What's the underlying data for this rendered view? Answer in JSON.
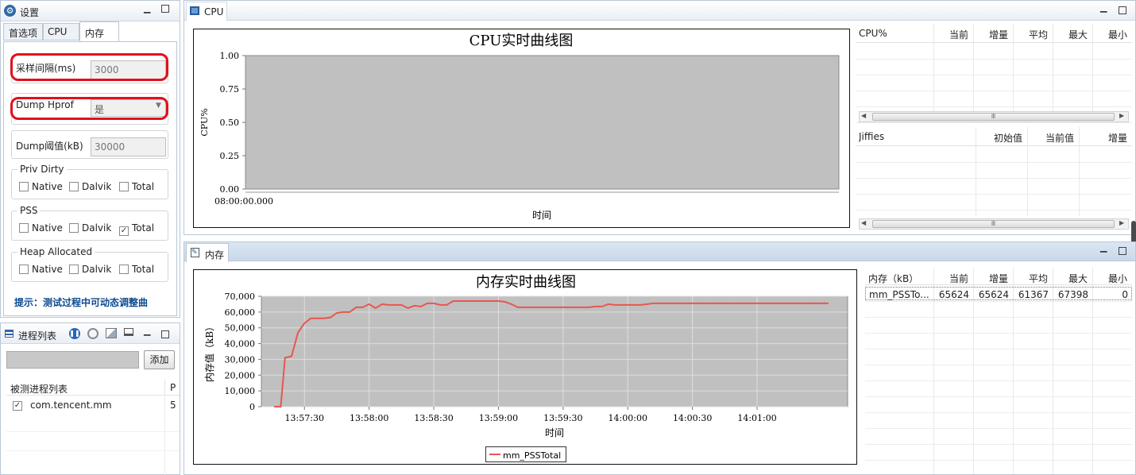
{
  "settings": {
    "title": "设置",
    "tabs": [
      "首选项",
      "CPU",
      "内存"
    ],
    "active_tab": 2,
    "sample_interval_label": "采样间隔(ms)",
    "sample_interval_value": "3000",
    "dump_hprof_label": "Dump Hprof",
    "dump_hprof_value": "是",
    "dump_threshold_label": "Dump阈值(kB)",
    "dump_threshold_value": "30000",
    "groups": [
      {
        "title": "Priv Dirty",
        "options": [
          {
            "label": "Native",
            "checked": false
          },
          {
            "label": "Dalvik",
            "checked": false
          },
          {
            "label": "Total",
            "checked": false
          }
        ]
      },
      {
        "title": "PSS",
        "options": [
          {
            "label": "Native",
            "checked": false
          },
          {
            "label": "Dalvik",
            "checked": false
          },
          {
            "label": "Total",
            "checked": true
          }
        ]
      },
      {
        "title": "Heap Allocated",
        "options": [
          {
            "label": "Native",
            "checked": false
          },
          {
            "label": "Dalvik",
            "checked": false
          },
          {
            "label": "Total",
            "checked": false
          }
        ]
      }
    ],
    "hint": "提示：测试过程中可动态调整曲"
  },
  "process": {
    "title": "进程列表",
    "input_value": "",
    "add_button": "添加",
    "columns": [
      "被测进程列表",
      "P"
    ],
    "rows": [
      {
        "name": "com.tencent.mm",
        "p": "5",
        "checked": true
      }
    ]
  },
  "cpu": {
    "tab_title": "CPU",
    "table1_columns": [
      "CPU%",
      "当前",
      "增量",
      "平均",
      "最大",
      "最小"
    ],
    "table2_columns": [
      "Jiffies",
      "初始值",
      "当前值",
      "增量"
    ],
    "scroll_grip": "Ⅲ"
  },
  "memory": {
    "tab_title": "内存",
    "table_columns": [
      "内存（kB）",
      "当前",
      "增量",
      "平均",
      "最大",
      "最小"
    ],
    "table_rows": [
      [
        "mm_PSSTo...",
        "65624",
        "65624",
        "61367",
        "67398",
        "0"
      ]
    ]
  },
  "chart_data": [
    {
      "type": "line",
      "title": "CPU实时曲线图",
      "xlabel": "时间",
      "ylabel": "CPU%",
      "x_ticks": [
        "08:00:00.000"
      ],
      "y_ticks": [
        "1.00",
        "0.75",
        "0.50",
        "0.25",
        "0.00"
      ],
      "ylim": [
        0,
        1
      ],
      "series": [],
      "grid": false,
      "background": "#c0c0c0"
    },
    {
      "type": "line",
      "title": "内存实时曲线图",
      "xlabel": "时间",
      "ylabel": "内存值（kB）",
      "x_ticks": [
        "13:57:30",
        "13:58:00",
        "13:58:30",
        "13:59:00",
        "13:59:30",
        "14:00:00",
        "14:00:30",
        "14:01:00"
      ],
      "y_ticks": [
        "70,000",
        "60,000",
        "50,000",
        "40,000",
        "30,000",
        "20,000",
        "10,000",
        "0"
      ],
      "xlim": [
        -20,
        252
      ],
      "ylim": [
        0,
        70000
      ],
      "grid": true,
      "legend": "bottom-center",
      "background": "#c0c0c0",
      "series": [
        {
          "name": "mm_PSSTotal",
          "color": "#e8574e",
          "x": [
            -14,
            -11,
            -9,
            -6,
            -3,
            0,
            3,
            6,
            9,
            12,
            15,
            18,
            21,
            24,
            27,
            30,
            33,
            36,
            39,
            42,
            45,
            48,
            51,
            54,
            57,
            60,
            63,
            66,
            69,
            72,
            75,
            78,
            81,
            84,
            87,
            90,
            93,
            96,
            99,
            102,
            105,
            108,
            111,
            114,
            117,
            120,
            123,
            126,
            129,
            132,
            135,
            138,
            141,
            144,
            147,
            150,
            153,
            156,
            159,
            162,
            165,
            168,
            171,
            174,
            177,
            180,
            183,
            186,
            189,
            192,
            195,
            198,
            201,
            204,
            207,
            210,
            213,
            216,
            219,
            222,
            225,
            228,
            231,
            234,
            237,
            240,
            243
          ],
          "y": [
            0,
            0,
            31000,
            32000,
            47000,
            53000,
            56000,
            56000,
            56000,
            56500,
            59500,
            60000,
            60000,
            63000,
            63000,
            65000,
            62500,
            65000,
            64500,
            64500,
            64500,
            62500,
            64000,
            63500,
            65500,
            65500,
            64500,
            64500,
            67000,
            67000,
            67000,
            67000,
            67000,
            67000,
            67000,
            67000,
            66500,
            65000,
            63000,
            63000,
            63000,
            63000,
            63000,
            63000,
            63000,
            63000,
            63000,
            63000,
            63000,
            63000,
            63500,
            63500,
            65000,
            64500,
            64500,
            64500,
            64500,
            64500,
            65000,
            65500,
            65500,
            65500,
            65500,
            65500,
            65500,
            65500,
            65500,
            65500,
            65500,
            65500,
            65500,
            65500,
            65500,
            65500,
            65500,
            65500,
            65500,
            65500,
            65500,
            65500,
            65500,
            65500,
            65500,
            65500,
            65500,
            65500,
            65500
          ]
        }
      ]
    }
  ]
}
